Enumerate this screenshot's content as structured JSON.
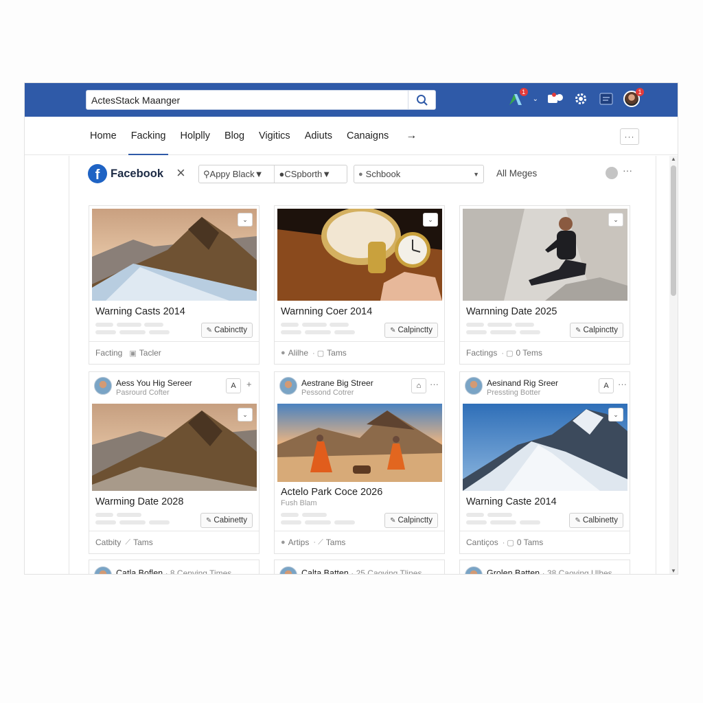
{
  "search": {
    "value": "ActesStack Maanger"
  },
  "topbar": {
    "notif_badge": "1",
    "avatar_badge": "1"
  },
  "nav": {
    "tabs": [
      "Home",
      "Facking",
      "Holplly",
      "Blog",
      "Vigitics",
      "Adiuts",
      "Canaigns"
    ],
    "arrow": "→",
    "more": "···"
  },
  "filters": {
    "brand": "Facebook",
    "close": "×",
    "select1a": "Appy Black",
    "select1b": "CSpborth",
    "select2": "Schbook",
    "all": "All Meges",
    "more": "···"
  },
  "cards_row1": [
    {
      "title": "Warning Casts 2014",
      "button": "Cabinctty",
      "foot": [
        "Facting",
        "Tacler"
      ]
    },
    {
      "title": "Warnning Coer 2014",
      "button": "Calpinctty",
      "foot": [
        "Alilhe",
        "Tams"
      ]
    },
    {
      "title": "Warnning Date 2025",
      "button": "Calpinctty",
      "foot": [
        "Factings",
        "0 Tems"
      ]
    }
  ],
  "cards_row2": [
    {
      "name": "Aess You Hig Sereer",
      "role": "Pasrourd Cofter",
      "title": "Warming Date 2028",
      "sub": "",
      "button": "Cabinetty",
      "foot": [
        "Catbity",
        "Tams"
      ],
      "icon": "A",
      "dots": "+"
    },
    {
      "name": "Aestrane Big Streer",
      "role": "Pessond Cotrer",
      "title": "Actelo Park Coce 2026",
      "sub": "Fush Blam",
      "button": "Calpinctty",
      "foot": [
        "Artips",
        "Tams"
      ],
      "icon": "⌂",
      "dots": "···"
    },
    {
      "name": "Aesinand Rig Sreer",
      "role": "Pressting Botter",
      "title": "Warning Caste 2014",
      "sub": "",
      "button": "Calbinetty",
      "foot": [
        "Cantiços",
        "0 Tams"
      ],
      "icon": "A",
      "dots": "···"
    }
  ],
  "bottom_rows": [
    {
      "name": "Catla Boflen",
      "meta": "· 8 Cepving Times"
    },
    {
      "name": "Calta Batten",
      "meta": "· 25 Caoying Tlines"
    },
    {
      "name": "Grolen Batten",
      "meta": "· 38 Caoying Ulhes"
    }
  ]
}
